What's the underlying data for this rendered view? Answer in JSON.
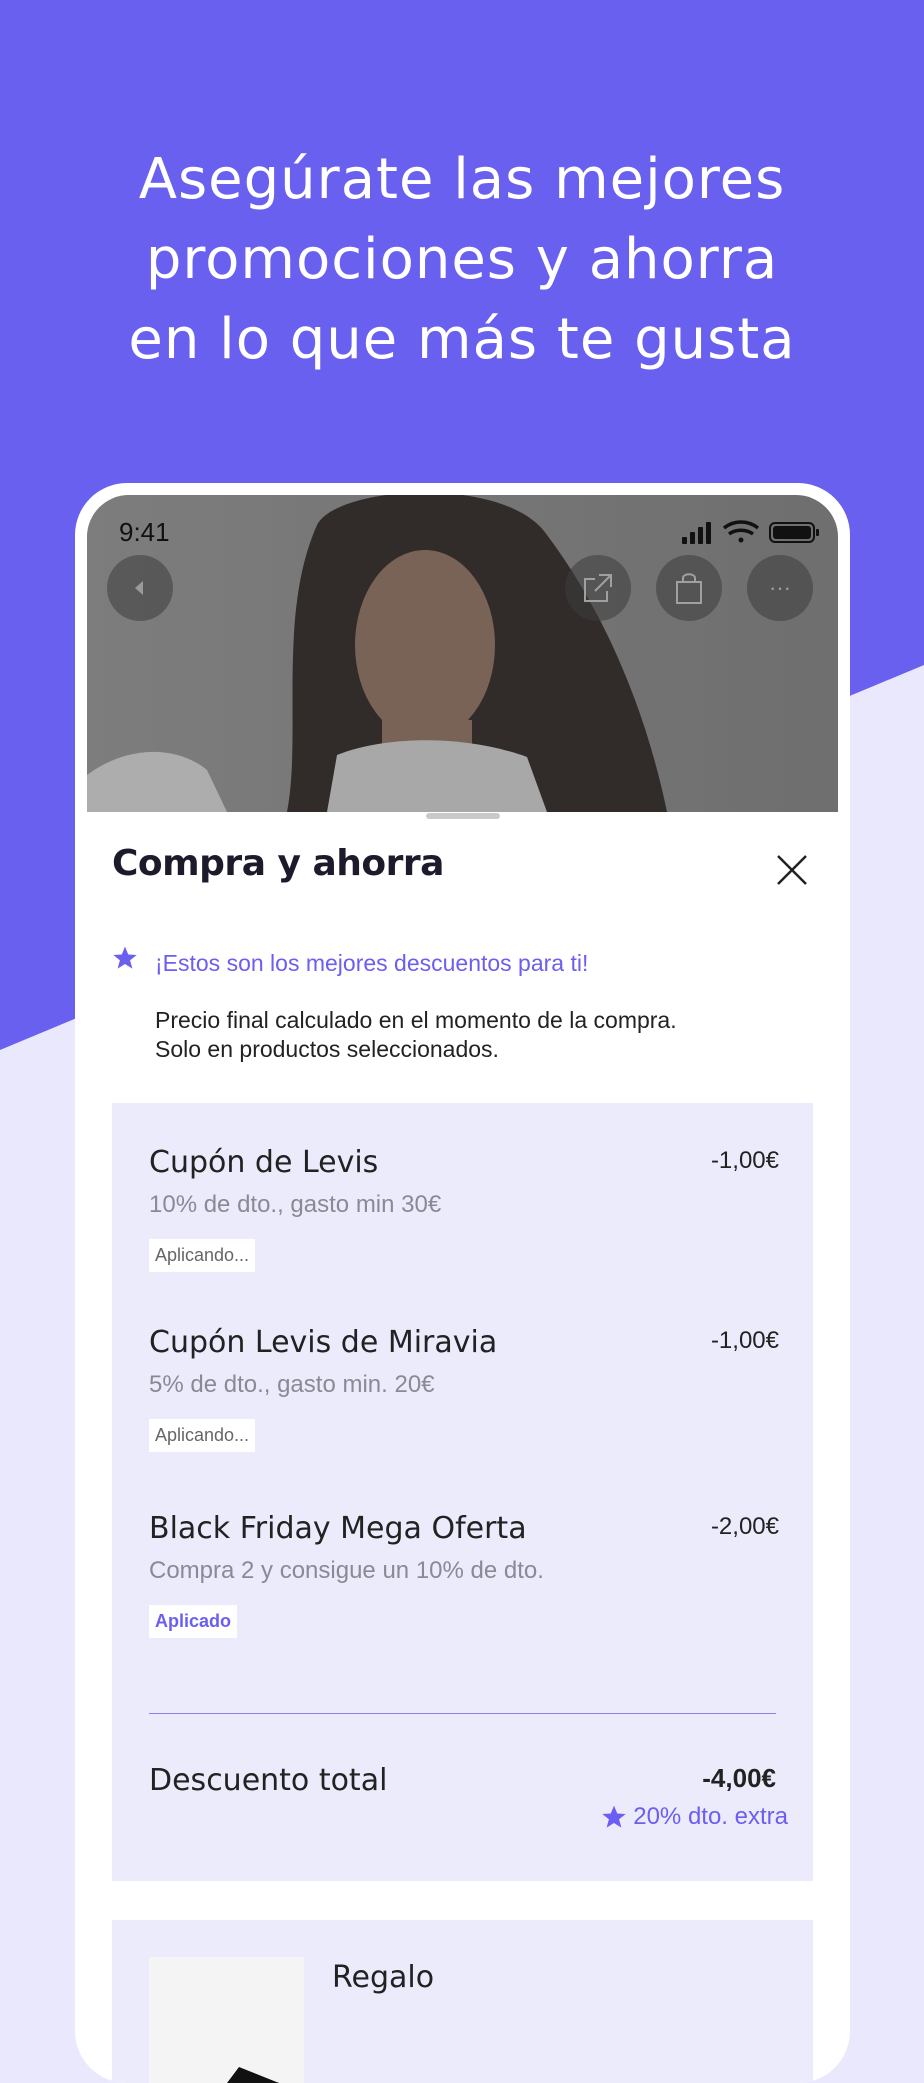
{
  "headline": {
    "line1": "Asegúrate las mejores",
    "line2": "promociones y ahorra",
    "line3": "en lo que más te gusta"
  },
  "colors": {
    "brand": "#6960f0",
    "lavender": "#eae8fc",
    "card": "#ecebfc",
    "accent_text": "#6b5ef0"
  },
  "status_bar": {
    "time": "9:41"
  },
  "hero_actions": {
    "back_icon": "back-arrow-icon",
    "share_icon": "share-icon",
    "cart_icon": "shopping-bag-icon",
    "more_icon": "more-dots-icon",
    "more_label": "···"
  },
  "sheet": {
    "title": "Compra y ahorra",
    "promo_text": "¡Estos son los mejores descuentos para ti!",
    "note_line1": "Precio final calculado en el momento de la compra.",
    "note_line2": "Solo en productos seleccionados."
  },
  "coupons": [
    {
      "name": "Cupón de Levis",
      "amount": "-1,00€",
      "desc": "10% de dto., gasto min 30€",
      "badge": "Aplicando..."
    },
    {
      "name": "Cupón Levis de Miravia",
      "amount": "-1,00€",
      "desc": "5% de dto., gasto min. 20€",
      "badge": "Aplicando..."
    },
    {
      "name": "Black Friday Mega Oferta",
      "amount": "-2,00€",
      "desc": "Compra 2 y consigue un 10% de dto.",
      "badge": "Aplicado"
    }
  ],
  "total": {
    "label": "Descuento total",
    "amount": "-4,00€",
    "extra": "20% dto. extra"
  },
  "gift": {
    "label": "Regalo"
  }
}
